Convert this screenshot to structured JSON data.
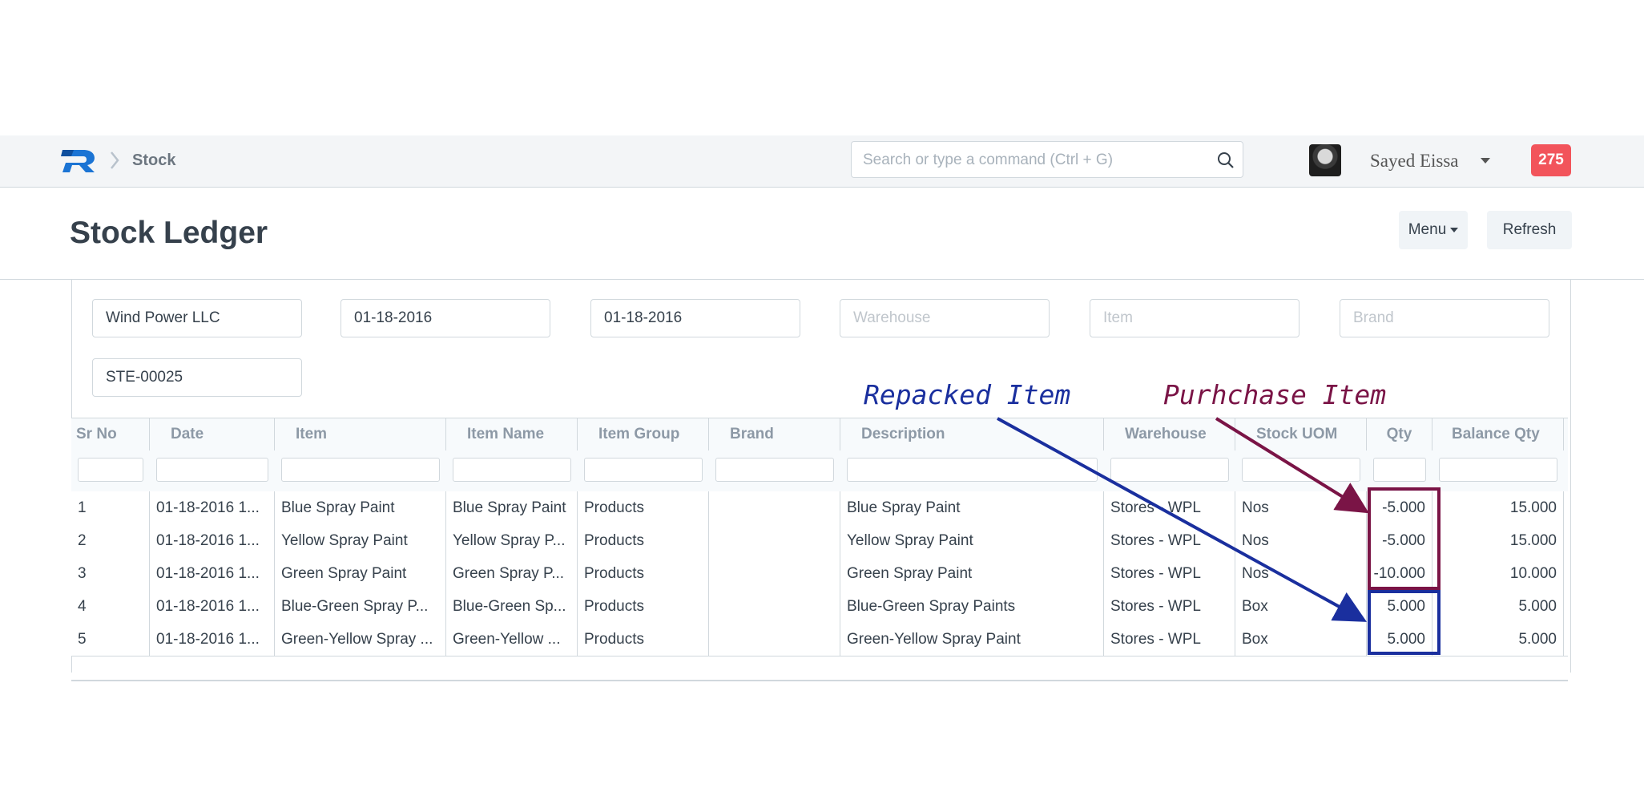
{
  "navbar": {
    "breadcrumb": "Stock",
    "search_placeholder": "Search or type a command (Ctrl + G)",
    "user_name": "Sayed Eissa",
    "notification_count": "275"
  },
  "page": {
    "title": "Stock Ledger",
    "menu_label": "Menu",
    "refresh_label": "Refresh"
  },
  "filters": {
    "company": "Wind Power LLC",
    "from_date": "01-18-2016",
    "to_date": "01-18-2016",
    "warehouse_placeholder": "Warehouse",
    "item_placeholder": "Item",
    "brand_placeholder": "Brand",
    "voucher_no": "STE-00025"
  },
  "table": {
    "columns": [
      "Sr No",
      "Date",
      "Item",
      "Item Name",
      "Item Group",
      "Brand",
      "Description",
      "Warehouse",
      "Stock UOM",
      "Qty",
      "Balance Qty"
    ],
    "rows": [
      [
        "1",
        "01-18-2016 1...",
        "Blue Spray Paint",
        "Blue Spray Paint",
        "Products",
        "",
        "Blue Spray Paint",
        "Stores - WPL",
        "Nos",
        "-5.000",
        "15.000"
      ],
      [
        "2",
        "01-18-2016 1...",
        "Yellow Spray Paint",
        "Yellow Spray P...",
        "Products",
        "",
        "Yellow Spray Paint",
        "Stores - WPL",
        "Nos",
        "-5.000",
        "15.000"
      ],
      [
        "3",
        "01-18-2016 1...",
        "Green Spray Paint",
        "Green Spray P...",
        "Products",
        "",
        "Green Spray Paint",
        "Stores - WPL",
        "Nos",
        "-10.000",
        "10.000"
      ],
      [
        "4",
        "01-18-2016 1...",
        "Blue-Green Spray P...",
        "Blue-Green Sp...",
        "Products",
        "",
        "Blue-Green Spray Paints",
        "Stores - WPL",
        "Box",
        "5.000",
        "5.000"
      ],
      [
        "5",
        "01-18-2016 1...",
        "Green-Yellow Spray ...",
        "Green-Yellow ...",
        "Products",
        "",
        "Green-Yellow Spray Paint",
        "Stores - WPL",
        "Box",
        "5.000",
        "5.000"
      ]
    ]
  },
  "annotations": {
    "repacked": "Repacked Item",
    "purchase": "Purhchase Item",
    "repacked_color": "#1a2f9e",
    "purchase_color": "#7a1446"
  },
  "colors": {
    "navbar_bg": "#f3f5f7",
    "badge": "#f2545b",
    "logo_blue": "#1b74d4"
  }
}
